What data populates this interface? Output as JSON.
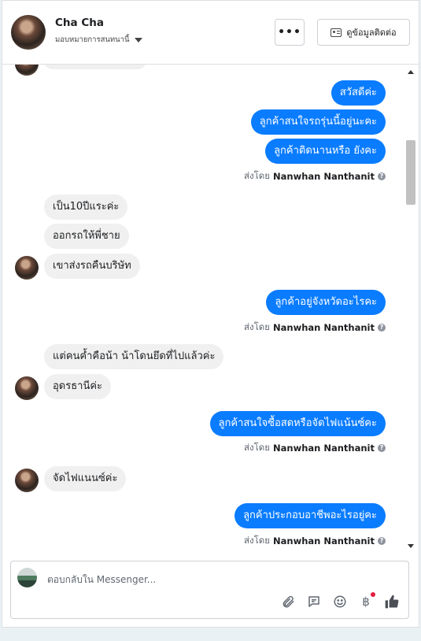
{
  "header": {
    "name": "Cha Cha",
    "assign_label": "มอบหมายการสนทนานี้",
    "more_label": "•••",
    "contact_label": "ดูข้อมูลติดต่อ"
  },
  "messages": {
    "m1": "สวัสดีค่ะ",
    "m2": "ลูกค้าสนใจรถรุ่นนี้อยู่นะคะ",
    "m3": "ลูกค้าติดนานหรือ ยังคะ",
    "m4": "เป็น10ปีแระค่ะ",
    "m5": "ออกรถให้พี่ชาย",
    "m6": "เขาส่งรถคืนบริษัท",
    "m7": "ลูกค้าอยู่จังหวัดอะไรคะ",
    "m8": "แต่คนค้ำคือน้า น้าโดนยึดที่ไปแล้วค่ะ",
    "m9": "อุดรธานีค่ะ",
    "m10": "ลูกค้าสนใจซื้อสดหรือจัดไฟแน้นซ์คะ",
    "m11": "จัดไฟแนนซ์ค่ะ",
    "m12": "ลูกค้าประกอบอาชีพอะไรอยู่คะ"
  },
  "sent_by": {
    "prefix": "ส่งโดย",
    "sender": "Nanwhan Nanthanit"
  },
  "composer": {
    "placeholder": "ตอบกลับใน Messenger...",
    "icons": [
      "paperclip-icon",
      "comment-icon",
      "emoji-icon",
      "baht-icon",
      "like-icon"
    ]
  },
  "colors": {
    "outgoing": "#0a7cff",
    "incoming": "#f0f0f0"
  }
}
